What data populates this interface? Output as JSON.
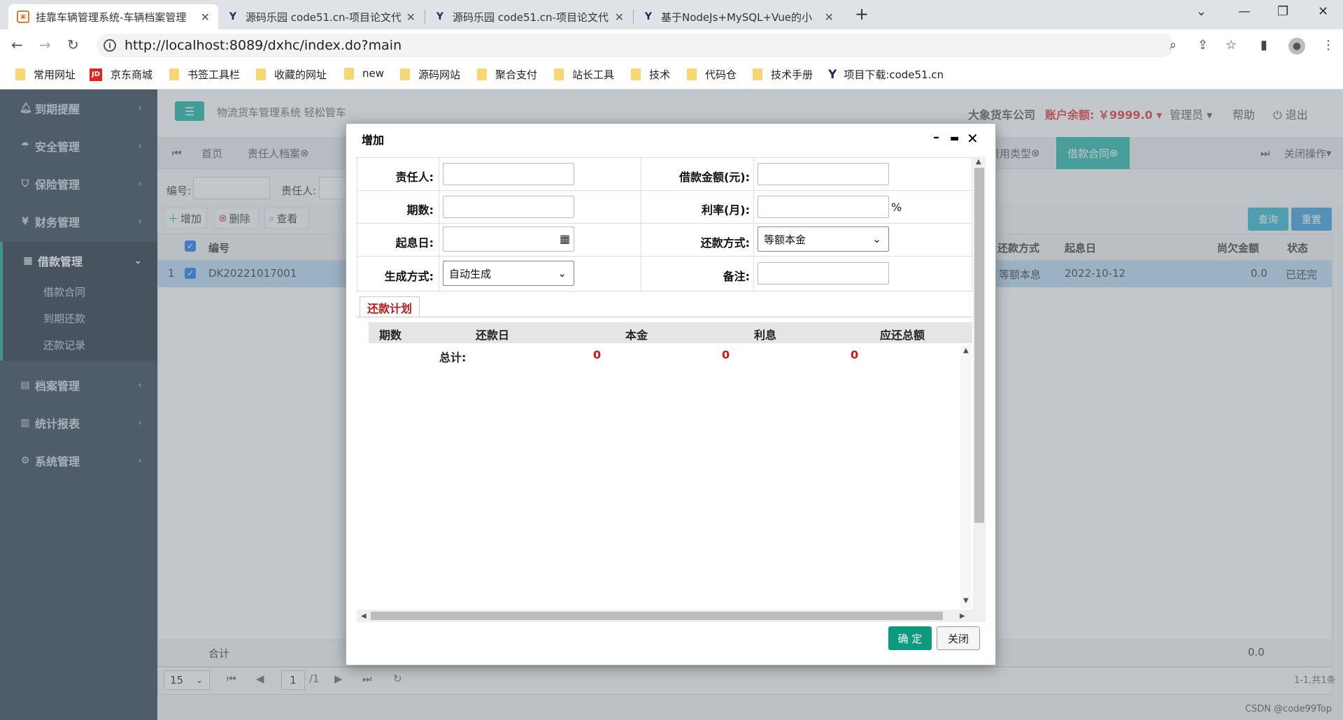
{
  "browser": {
    "tabs": [
      {
        "label": "挂靠车辆管理系统-车辆档案管理",
        "active": true
      },
      {
        "label": "源码乐园 code51.cn-项目论文代"
      },
      {
        "label": "源码乐园 code51.cn-项目论文代"
      },
      {
        "label": "基于NodeJs+MySQL+Vue的小"
      }
    ],
    "url": "http://localhost:8089/dxhc/index.do?main",
    "bookmarks": [
      "常用网址",
      "京东商城",
      "书签工具栏",
      "收藏的网址",
      "new",
      "源码网站",
      "聚合支付",
      "站长工具",
      "技术",
      "代码仓",
      "技术手册",
      "项目下载:code51.cn"
    ]
  },
  "sidebar": {
    "items": [
      {
        "label": "到期提醒",
        "icon": "bell-icon"
      },
      {
        "label": "安全管理",
        "icon": "umbrella-icon"
      },
      {
        "label": "保险管理",
        "icon": "shield-icon"
      },
      {
        "label": "财务管理",
        "icon": "yen-icon"
      },
      {
        "label": "借款管理",
        "icon": "table-icon"
      },
      {
        "label": "档案管理",
        "icon": "file-icon"
      },
      {
        "label": "统计报表",
        "icon": "chart-icon"
      },
      {
        "label": "系统管理",
        "icon": "gear-icon"
      }
    ],
    "subitems": [
      "借款合同",
      "到期还款",
      "还款记录"
    ]
  },
  "header": {
    "title": "物流货车管理系统 轻松管车",
    "company": "大象货车公司",
    "balance": "账户余额: ￥9999.0",
    "user": "管理员",
    "help": "帮助",
    "logout": "退出"
  },
  "apptabs": {
    "home": "首页",
    "t1": "责任人档案",
    "t2": "费用类型",
    "t3": "借款合同",
    "close_ops": "关闭操作"
  },
  "search": {
    "no_label": "编号:",
    "person_label": "责任人:",
    "query": "查询",
    "reset": "重置"
  },
  "toolbar": {
    "add": "增加",
    "delete": "删除",
    "view": "查看"
  },
  "grid": {
    "headers": {
      "no": "编号",
      "method": "还款方式",
      "start": "起息日",
      "owed": "尚欠金额",
      "status": "状态"
    },
    "row": {
      "index": "1",
      "no": "DK20221017001",
      "method": "等额本息",
      "start": "2022-10-12",
      "owed": "0.0",
      "status": "已还完"
    },
    "footer_label": "合计",
    "footer_owed": "0.0"
  },
  "pager": {
    "size": "15",
    "page": "1",
    "total_pages": "/1",
    "summary": "1-1,共1条"
  },
  "dialog": {
    "title": "增加",
    "labels": {
      "person": "责任人:",
      "amount": "借款金额(元):",
      "periods": "期数:",
      "rate": "利率(月):",
      "rate_unit": "%",
      "start_date": "起息日:",
      "repay_method": "还款方式:",
      "gen_method": "生成方式:",
      "note": "备注:"
    },
    "repay_method_value": "等额本金",
    "gen_method_value": "自动生成",
    "plan_tab": "还款计划",
    "plan_headers": [
      "期数",
      "还款日",
      "本金",
      "利息",
      "应还总额"
    ],
    "total_label": "总计:",
    "totals": [
      "0",
      "0",
      "0"
    ],
    "confirm": "确 定",
    "close": "关闭"
  },
  "watermark": "CSDN @code99Top"
}
